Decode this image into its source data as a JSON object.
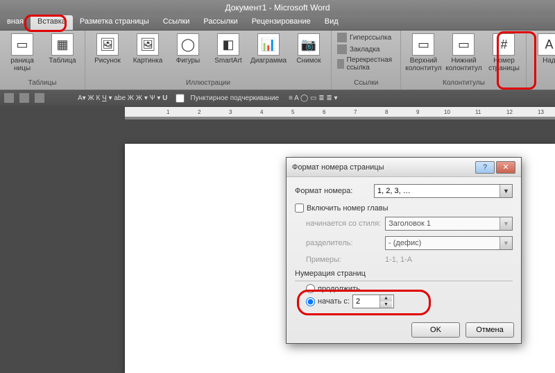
{
  "title": "Документ1 - Microsoft Word",
  "tabs": [
    "вная",
    "Вставка",
    "Разметка страницы",
    "Ссылки",
    "Рассылки",
    "Рецензирование",
    "Вид"
  ],
  "activeTab": 1,
  "ribbon": {
    "groups": [
      {
        "label": "Таблицы",
        "buttons": [
          {
            "label": "раница"
          },
          {
            "label": "Таблица"
          }
        ],
        "leftover": "ницы"
      },
      {
        "label": "Иллюстрации",
        "buttons": [
          {
            "label": "Рисунок"
          },
          {
            "label": "Картинка"
          },
          {
            "label": "Фигуры"
          },
          {
            "label": "SmartArt"
          },
          {
            "label": "Диаграмма"
          },
          {
            "label": "Снимок"
          }
        ]
      },
      {
        "label": "Ссылки",
        "links": [
          "Гиперссылка",
          "Закладка",
          "Перекрестная ссылка"
        ]
      },
      {
        "label": "Колонтитулы",
        "buttons": [
          {
            "label": "Верхний колонтитул"
          },
          {
            "label": "Нижний колонтитул"
          },
          {
            "label": "Номер страницы"
          }
        ]
      },
      {
        "label": "",
        "buttons": [
          {
            "label": "Над"
          }
        ]
      }
    ]
  },
  "toolbar2": {
    "dotted": "Пунктирное подчеркивание"
  },
  "rulerTicks": [
    "1",
    "2",
    "3",
    "4",
    "5",
    "6",
    "7",
    "8",
    "9",
    "10",
    "11",
    "12",
    "13"
  ],
  "dialog": {
    "title": "Формат номера страницы",
    "formatLabel": "Формат номера:",
    "formatValue": "1, 2, 3, …",
    "includeChapter": "Включить номер главы",
    "startsWithStyleLabel": "начинается со стиля:",
    "startsWithStyleValue": "Заголовок 1",
    "separatorLabel": "разделитель:",
    "separatorValue": "- (дефис)",
    "examplesLabel": "Примеры:",
    "examplesValue": "1-1, 1-A",
    "numberingLabel": "Нумерация страниц",
    "continueLabel": "продолжить",
    "startAtLabel": "начать с:",
    "startAtValue": "2",
    "ok": "OK",
    "cancel": "Отмена"
  }
}
